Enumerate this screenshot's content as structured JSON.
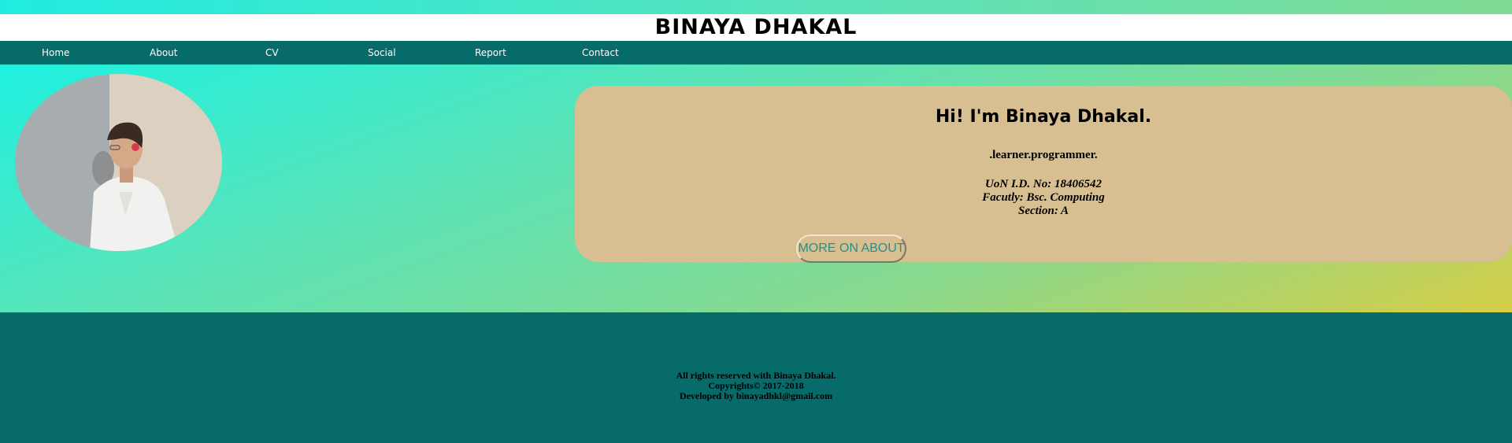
{
  "site": {
    "title": "BINAYA DHAKAL"
  },
  "nav": {
    "items": [
      {
        "label": "Home"
      },
      {
        "label": "About"
      },
      {
        "label": "CV"
      },
      {
        "label": "Social"
      },
      {
        "label": "Report"
      },
      {
        "label": "Contact"
      }
    ]
  },
  "intro": {
    "heading": "Hi! I'm Binaya Dhakal.",
    "tagline": ".learner.programmer.",
    "info": [
      "UoN I.D. No: 18406542",
      "Facutly: Bsc. Computing",
      "Section: A"
    ],
    "button_label": "MORE ON ABOUT"
  },
  "footer": {
    "lines": [
      "All rights reserved with Binaya Dhakal.",
      "Copyrights© 2017-2018",
      "Developed by binayadhkl@gmail.com"
    ]
  },
  "colors": {
    "nav_background": "#066b69",
    "card_background": "#d8bf91",
    "button_text": "#2a8f88"
  }
}
